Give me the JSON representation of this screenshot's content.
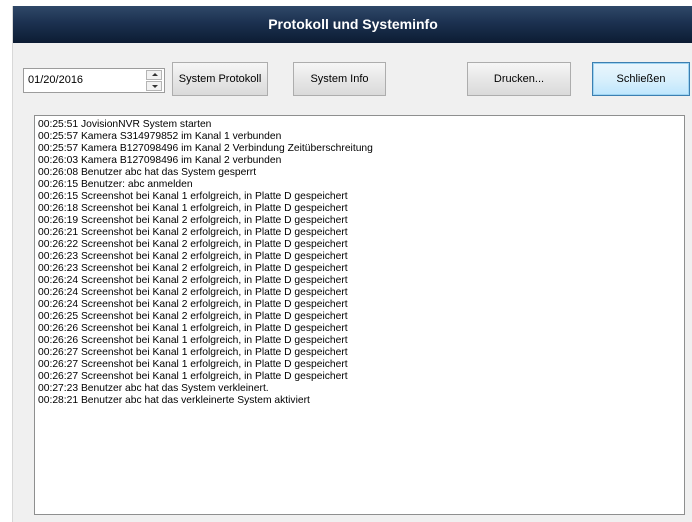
{
  "window": {
    "title": "Protokoll und Systeminfo"
  },
  "toolbar": {
    "date_value": "01/20/2016",
    "system_protokoll_label": "System Protokoll",
    "system_info_label": "System Info",
    "drucken_label": "Drucken...",
    "schliessen_label": "Schließen"
  },
  "log": {
    "lines": [
      "00:25:51 JovisionNVR System starten",
      "00:25:57 Kamera S314979852 im Kanal 1 verbunden",
      "00:25:57 Kamera B127098496 im Kanal 2 Verbindung Zeitüberschreitung",
      "00:26:03 Kamera B127098496 im Kanal 2 verbunden",
      "00:26:08 Benutzer abc hat das System gesperrt",
      "00:26:15 Benutzer: abc anmelden",
      "00:26:15 Screenshot bei Kanal 1 erfolgreich, in Platte D gespeichert",
      "00:26:18 Screenshot bei Kanal 1 erfolgreich, in Platte D gespeichert",
      "00:26:19 Screenshot bei Kanal 2 erfolgreich, in Platte D gespeichert",
      "00:26:21 Screenshot bei Kanal 2 erfolgreich, in Platte D gespeichert",
      "00:26:22 Screenshot bei Kanal 2 erfolgreich, in Platte D gespeichert",
      "00:26:23 Screenshot bei Kanal 2 erfolgreich, in Platte D gespeichert",
      "00:26:23 Screenshot bei Kanal 2 erfolgreich, in Platte D gespeichert",
      "00:26:24 Screenshot bei Kanal 2 erfolgreich, in Platte D gespeichert",
      "00:26:24 Screenshot bei Kanal 2 erfolgreich, in Platte D gespeichert",
      "00:26:24 Screenshot bei Kanal 2 erfolgreich, in Platte D gespeichert",
      "00:26:25 Screenshot bei Kanal 2 erfolgreich, in Platte D gespeichert",
      "00:26:26 Screenshot bei Kanal 1 erfolgreich, in Platte D gespeichert",
      "00:26:26 Screenshot bei Kanal 1 erfolgreich, in Platte D gespeichert",
      "00:26:27 Screenshot bei Kanal 1 erfolgreich, in Platte D gespeichert",
      "00:26:27 Screenshot bei Kanal 1 erfolgreich, in Platte D gespeichert",
      "00:26:27 Screenshot bei Kanal 1 erfolgreich, in Platte D gespeichert",
      "00:27:23 Benutzer abc hat das System verkleinert.",
      "00:28:21 Benutzer abc hat das verkleinerte System aktiviert"
    ]
  }
}
